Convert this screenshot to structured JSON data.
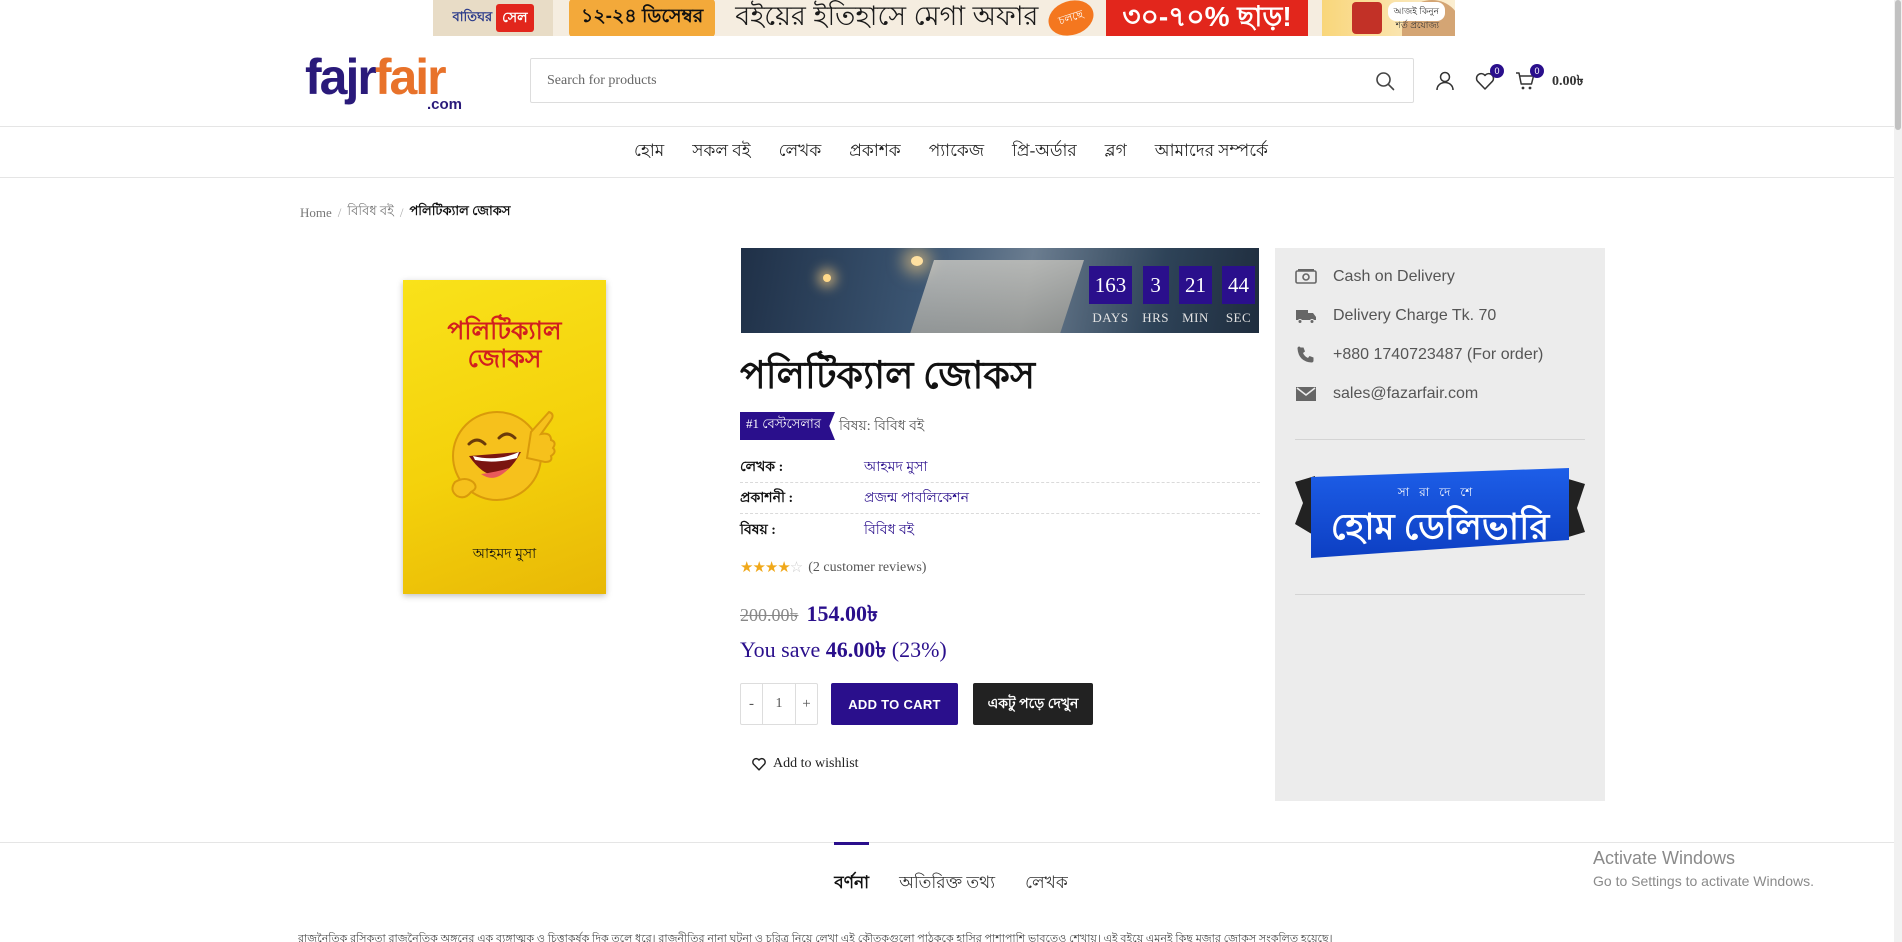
{
  "promo": {
    "brand_a": "বাতিঘর",
    "brand_b": "সেল",
    "dates": "১২-২৪ ডিসেম্বর",
    "headline": "বইয়ের ইতিহাসে মেগা অফার",
    "badge": "চলছে",
    "discount": "৩০-৭০% ছাড়!",
    "tag": "আজই কিনুন",
    "tag2": "শর্ত প্রযোজ্য"
  },
  "header": {
    "logo_part1": "fajr",
    "logo_part2": "fair",
    "logo_suffix": ".com",
    "search_placeholder": "Search for products",
    "wishlist_count": "0",
    "cart_count": "0",
    "cart_total": "0.00৳"
  },
  "nav": [
    "হোম",
    "সকল বই",
    "লেখক",
    "প্রকাশক",
    "প্যাকেজ",
    "প্রি-অর্ডার",
    "ব্লগ",
    "আমাদের সম্পর্কে"
  ],
  "breadcrumb": {
    "home": "Home",
    "category": "বিবিধ বই",
    "current": "পলিটিক্যাল জোকস"
  },
  "cover": {
    "title": "পলিটিক্যাল জোকস",
    "author": "আহমদ মুসা"
  },
  "countdown": [
    {
      "value": "163",
      "label": "DAYS"
    },
    {
      "value": "3",
      "label": "HRS"
    },
    {
      "value": "21",
      "label": "MIN"
    },
    {
      "value": "44",
      "label": "SEC"
    }
  ],
  "product": {
    "title": "পলিটিক্যাল জোকস",
    "bestseller": "#1 বেস্টসেলার",
    "category_text": "বিষয়: বিবিধ বই",
    "meta": [
      {
        "key": "লেখক :",
        "value": "আহমদ মুসা"
      },
      {
        "key": "প্রকাশনী :",
        "value": "প্রজন্ম পাবলিকেশন"
      },
      {
        "key": "বিষয় :",
        "value": "বিবিধ বই"
      }
    ],
    "rating": 4,
    "rating_max": 5,
    "reviews": "(2 customer reviews)",
    "old_price": "200.00৳",
    "new_price": "154.00৳",
    "save_prefix": "You save",
    "save_amount": "46.00৳",
    "save_percent": "(23%)",
    "qty_minus": "-",
    "qty": "1",
    "qty_plus": "+",
    "add_to_cart": "ADD TO CART",
    "read_button": "একটু পড়ে দেখুন",
    "wishlist": "Add to wishlist"
  },
  "sidebar": {
    "items": [
      {
        "icon": "cash-icon",
        "text": "Cash on Delivery"
      },
      {
        "icon": "truck-icon",
        "text": "Delivery Charge Tk. 70"
      },
      {
        "icon": "phone-icon",
        "text": "+880 1740723487 (For order)"
      },
      {
        "icon": "mail-icon",
        "text": "sales@fazarfair.com"
      }
    ],
    "ribbon_small": "সারাদেশে",
    "ribbon_big": "হোম ডেলিভারি"
  },
  "tabs": [
    "বর্ণনা",
    "অতিরিক্ত তথ্য",
    "লেখক"
  ],
  "description_snippet": "রাজনৈতিক রসিকতা রাজনৈতিক অঙ্গনের এক ব্যঙ্গাত্মক ও চিত্তাকর্ষক দিক তুলে ধরে। রাজনীতির নানা ঘটনা ও চরিত্র নিয়ে লেখা এই কৌতুকগুলো পাঠককে হাসির পাশাপাশি ভাবতেও শেখায়। এই বইয়ে এমনই কিছু মজার জোকস সংকলিত হয়েছে।",
  "watermark": {
    "line1": "Activate Windows",
    "line2": "Go to Settings to activate Windows."
  },
  "colors": {
    "brand_primary": "#2a0f8c",
    "brand_accent": "#e8722a",
    "promo_red": "#e2261c",
    "sidebar_bg": "#ececec"
  }
}
